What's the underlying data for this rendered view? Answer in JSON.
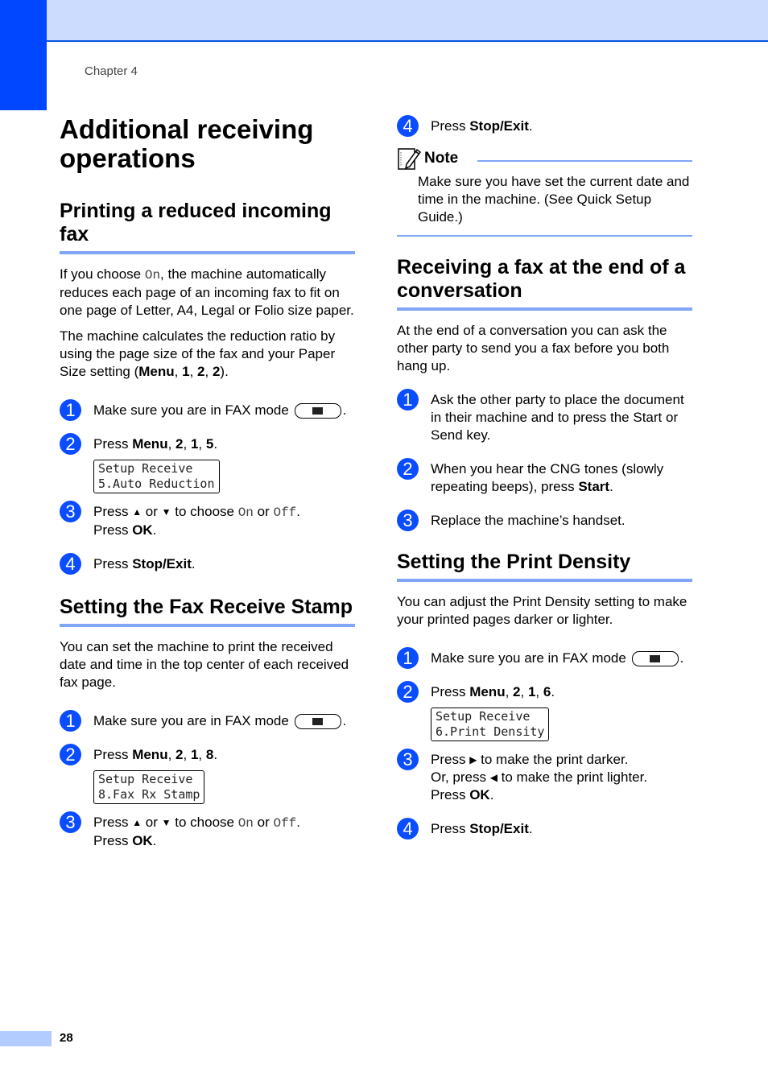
{
  "header": {
    "chapter": "Chapter 4"
  },
  "footer": {
    "page_number": "28"
  },
  "title": "Additional receiving operations",
  "sections": {
    "reduced": {
      "heading": "Printing a reduced incoming fax",
      "para1_a": "If you choose ",
      "para1_on": "On",
      "para1_b": ", the machine automatically reduces each page of an incoming fax to fit on one page of Letter, A4, Legal or Folio size paper.",
      "para2_a": "The machine calculates the reduction ratio by using the page size of the fax and your Paper Size setting (",
      "para2_menu": "Menu",
      "para2_k1": "1",
      "para2_k2": "2",
      "para2_k3": "2",
      "para2_end": ").",
      "steps": [
        {
          "num": "1",
          "text": "Make sure you are in FAX mode"
        },
        {
          "num": "2",
          "pre": "Press ",
          "menu": "Menu",
          "keys": [
            "2",
            "1",
            "5"
          ],
          "lcd": "Setup Receive\n5.Auto Reduction"
        },
        {
          "num": "3",
          "pre": "Press ",
          "up": "▲",
          "or": " or ",
          "down": "▼",
          "mid": " to choose ",
          "on": "On",
          "or2": " or ",
          "off": "Off",
          "line2_pre": "Press ",
          "ok": "OK"
        },
        {
          "num": "4",
          "pre": "Press ",
          "key": "Stop/Exit"
        }
      ]
    },
    "stamp": {
      "heading": "Setting the Fax Receive Stamp",
      "para": "You can set the machine to print the received date and time in the top center of each received fax page.",
      "steps": [
        {
          "num": "1",
          "text": "Make sure you are in FAX mode"
        },
        {
          "num": "2",
          "pre": "Press ",
          "menu": "Menu",
          "keys": [
            "2",
            "1",
            "8"
          ],
          "lcd": "Setup Receive\n8.Fax Rx Stamp"
        },
        {
          "num": "3",
          "pre": "Press ",
          "up": "▲",
          "or": " or ",
          "down": "▼",
          "mid": " to choose ",
          "on": "On",
          "or2": " or ",
          "off": "Off",
          "line2_pre": "Press ",
          "ok": "OK"
        }
      ]
    },
    "stamp_cont": {
      "step4": {
        "num": "4",
        "pre": "Press ",
        "key": "Stop/Exit"
      },
      "note_title": "Note",
      "note_body": "Make sure you have set the current date and time in the machine. (See Quick Setup Guide.)"
    },
    "conversation": {
      "heading": "Receiving a fax at the end of a conversation",
      "para": "At the end of a conversation you can ask the other party to send you a fax before you both hang up.",
      "steps": [
        {
          "num": "1",
          "text": "Ask the other party to place the document in their machine and to press the Start or Send key."
        },
        {
          "num": "2",
          "pre": "When you hear the CNG tones (slowly repeating beeps), press ",
          "key": "Start"
        },
        {
          "num": "3",
          "text": "Replace the machine’s handset."
        }
      ]
    },
    "density": {
      "heading": "Setting the Print Density",
      "para": "You can adjust the Print Density setting to make your printed pages darker or lighter.",
      "steps": [
        {
          "num": "1",
          "text": "Make sure you are in FAX mode"
        },
        {
          "num": "2",
          "pre": "Press ",
          "menu": "Menu",
          "keys": [
            "2",
            "1",
            "6"
          ],
          "lcd": "Setup Receive\n6.Print Density"
        },
        {
          "num": "3",
          "pre": "Press ",
          "right": "▶",
          "l1": " to make the print darker.",
          "l2_pre": "Or, press ",
          "left": "◀",
          "l2": " to make the print lighter.",
          "line3_pre": "Press ",
          "ok": "OK"
        },
        {
          "num": "4",
          "pre": "Press ",
          "key": "Stop/Exit"
        }
      ]
    }
  }
}
